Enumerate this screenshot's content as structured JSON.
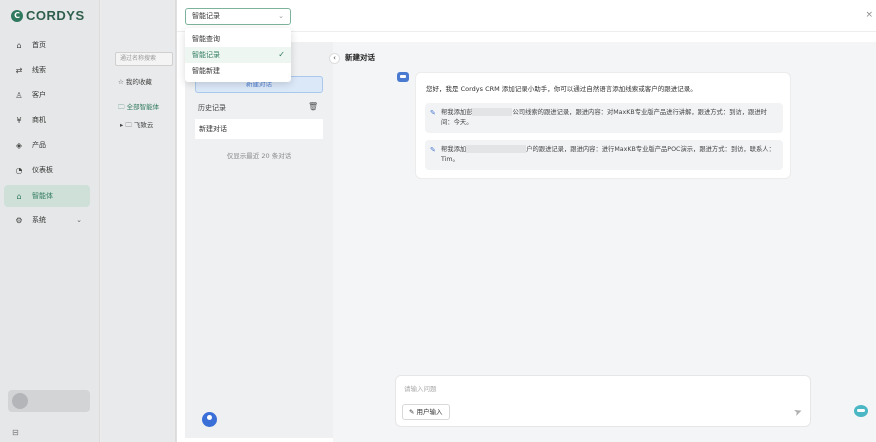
{
  "app": {
    "logo_text": "CORDYS",
    "logo_mark": "C"
  },
  "sidebar": {
    "items": [
      {
        "label": "首页",
        "icon": "home-icon",
        "glyph": "⌂"
      },
      {
        "label": "线索",
        "icon": "lead-icon",
        "glyph": "⇄"
      },
      {
        "label": "客户",
        "icon": "customer-icon",
        "glyph": "♙"
      },
      {
        "label": "商机",
        "icon": "opportunity-icon",
        "glyph": "¥"
      },
      {
        "label": "产品",
        "icon": "product-icon",
        "glyph": "◈"
      },
      {
        "label": "仪表板",
        "icon": "dashboard-icon",
        "glyph": "◔"
      },
      {
        "label": "智能体",
        "icon": "agent-icon",
        "glyph": "⌂"
      },
      {
        "label": "系统",
        "icon": "system-icon",
        "glyph": "⚙"
      }
    ],
    "active_index": 6,
    "system_chevron": "⌄"
  },
  "tree": {
    "search_placeholder": "通过名称搜索",
    "favorites": "☆ 我的收藏",
    "all_agents": "🗀 全部智能体",
    "sub_item": "▸ 🗀 飞致云"
  },
  "modal": {
    "select_value": "智能记录",
    "select_caret": "⌄",
    "close_glyph": "×",
    "dropdown_options": [
      "智能查询",
      "智能记录",
      "智能新建"
    ],
    "dropdown_selected_index": 1,
    "check_glyph": "✓"
  },
  "history": {
    "new_chat_button": "新建对话",
    "label": "历史记录",
    "trash_glyph": "🗑",
    "item": "新建对话",
    "note": "仅显示最近 20 条对话"
  },
  "chat": {
    "title": "新建对话",
    "collapse_glyph": "‹",
    "greeting": "您好，我是 Cordys CRM 添加记录小助手，你可以通过自然语言添加线索或客户的跟进记录。",
    "suggestion1_a": "帮我添加彭",
    "suggestion1_b": "公司线索的跟进记录，跟进内容：对MaxKB专业版产品进行讲解，跟进方式：到访，跟进时间：今天。",
    "suggestion2_a": "帮我添加",
    "suggestion2_b": "户的跟进记录，跟进内容：进行MaxKB专业版产品POC演示，跟进方式：到访，联系人：Tim。",
    "pen_glyph": "✎",
    "input_placeholder": "请输入问题",
    "user_input_button": "用户输入",
    "user_input_glyph": "✎",
    "send_glyph": "➤"
  },
  "colors": {
    "accent": "#2f7a5f",
    "blue": "#4a7bd0"
  }
}
